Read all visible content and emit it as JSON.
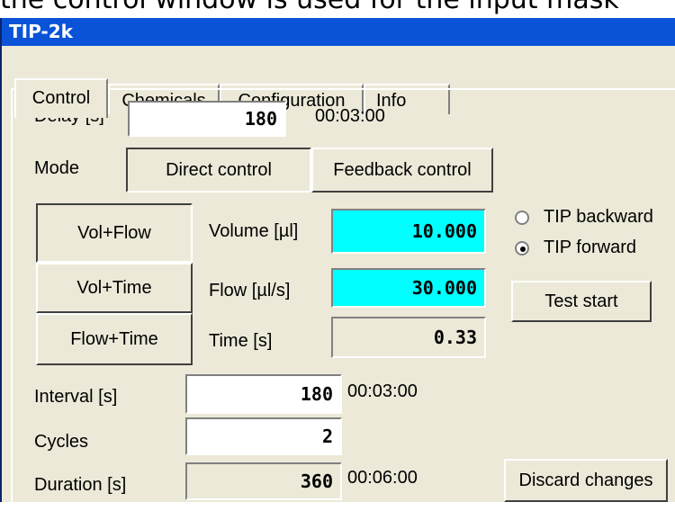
{
  "caption": "the control window is used for the input mask",
  "window": {
    "title": "TIP-2k"
  },
  "tabs": [
    "Control",
    "Chemicals",
    "Configuration",
    "Info"
  ],
  "delay": {
    "label": "Delay [s]",
    "value": "180",
    "time": "00:03:00"
  },
  "mode": {
    "label": "Mode",
    "direct": "Direct control",
    "feedback": "Feedback control",
    "selected": "Direct control"
  },
  "calc_modes": {
    "vol_flow": "Vol+Flow",
    "vol_time": "Vol+Time",
    "flow_time": "Flow+Time",
    "selected": "Vol+Flow"
  },
  "volume": {
    "label": "Volume [µl]",
    "value": "10.000"
  },
  "flow": {
    "label": "Flow [µl/s]",
    "value": "30.000"
  },
  "time": {
    "label": "Time [s]",
    "value": "0.33"
  },
  "direction": {
    "backward": "TIP backward",
    "forward": "TIP forward",
    "selected": "TIP forward"
  },
  "test_start": "Test start",
  "interval": {
    "label": "Interval [s]",
    "value": "180",
    "time": "00:03:00"
  },
  "cycles": {
    "label": "Cycles",
    "value": "2"
  },
  "duration": {
    "label": "Duration [s]",
    "value": "360",
    "time": "00:06:00"
  },
  "discard": "Discard changes",
  "colors": {
    "title_bar": "#0a53d8",
    "face": "#ece9d8",
    "highlight_field": "#00ffff"
  }
}
